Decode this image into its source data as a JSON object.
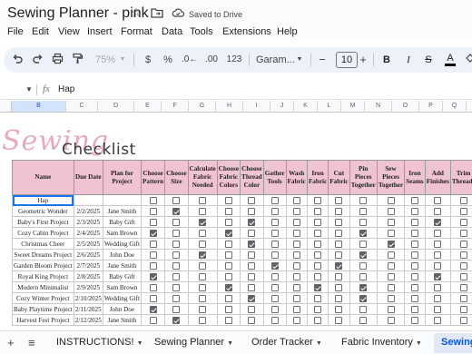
{
  "title_bar": {
    "doc_title": "Sewing Planner - pink",
    "saved_status": "Saved to Drive"
  },
  "menu": [
    "File",
    "Edit",
    "View",
    "Insert",
    "Format",
    "Data",
    "Tools",
    "Extensions",
    "Help"
  ],
  "toolbar": {
    "zoom": "75%",
    "currency": "$",
    "percent": "%",
    "decrease_decimal": ".0←",
    "increase_decimal": ".00",
    "number_format": "123",
    "font": "Garam...",
    "font_size": "10",
    "bold": "B",
    "italic": "I",
    "strikethrough": "S",
    "text_color": "A"
  },
  "formula_bar": {
    "fx": "fx",
    "value": "Hap"
  },
  "columns": [
    "B",
    "C",
    "D",
    "E",
    "F",
    "G",
    "H",
    "I",
    "J",
    "K",
    "L",
    "M",
    "N",
    "O",
    "P",
    "Q",
    "R"
  ],
  "sheet": {
    "script_title": "Sewing",
    "title": "Checklist",
    "headers": [
      "Name",
      "Due Date",
      "Plan for Project",
      "Choose Pattern",
      "Choose Size",
      "Calculate Fabric Needed",
      "Choose Fabric Colors",
      "Choose Thread Color",
      "Gather Tools",
      "Wash Fabric",
      "Iron Fabric",
      "Cut Fabric",
      "Pin Pieces Together",
      "Sew Pieces Together",
      "Iron Seams",
      "Add Finishes",
      "Trim Threads"
    ],
    "rows": [
      {
        "name": "Hap",
        "due": "",
        "plan": "",
        "checks": [
          0,
          0,
          0,
          0,
          0,
          0,
          0,
          0,
          0,
          0,
          0,
          0,
          0,
          0
        ]
      },
      {
        "name": "Geometric Wonder",
        "due": "2/2/2025",
        "plan": "Jane Smith",
        "checks": [
          0,
          1,
          0,
          0,
          0,
          0,
          0,
          0,
          0,
          0,
          0,
          0,
          0,
          0
        ]
      },
      {
        "name": "Baby's First Project",
        "due": "2/3/2025",
        "plan": "Baby Gift",
        "checks": [
          0,
          0,
          1,
          0,
          1,
          0,
          0,
          0,
          0,
          0,
          0,
          0,
          1,
          0
        ]
      },
      {
        "name": "Cozy Cabin Project",
        "due": "2/4/2025",
        "plan": "Sam Brown",
        "checks": [
          1,
          0,
          0,
          1,
          0,
          0,
          0,
          0,
          0,
          1,
          0,
          0,
          0,
          0
        ]
      },
      {
        "name": "Christmas Cheer",
        "due": "2/5/2025",
        "plan": "Wedding Gift",
        "checks": [
          0,
          0,
          0,
          0,
          1,
          0,
          0,
          0,
          0,
          0,
          1,
          0,
          0,
          0
        ]
      },
      {
        "name": "Sweet Dreams Project",
        "due": "2/6/2025",
        "plan": "John Doe",
        "checks": [
          0,
          0,
          1,
          0,
          0,
          0,
          0,
          0,
          0,
          1,
          0,
          0,
          0,
          0
        ]
      },
      {
        "name": "Garden Bloom Project",
        "due": "2/7/2025",
        "plan": "Jane Smith",
        "checks": [
          0,
          0,
          0,
          0,
          0,
          1,
          0,
          0,
          1,
          0,
          0,
          0,
          0,
          0
        ]
      },
      {
        "name": "Royal King Project",
        "due": "2/8/2025",
        "plan": "Baby Gift",
        "checks": [
          1,
          0,
          0,
          0,
          0,
          0,
          0,
          0,
          0,
          0,
          0,
          0,
          1,
          0
        ]
      },
      {
        "name": "Modern Minimalist",
        "due": "2/9/2025",
        "plan": "Sam Brown",
        "checks": [
          0,
          0,
          0,
          1,
          0,
          0,
          0,
          1,
          0,
          1,
          0,
          0,
          0,
          0
        ]
      },
      {
        "name": "Cozy Winter Project",
        "due": "2/10/2025",
        "plan": "Wedding Gift",
        "checks": [
          0,
          0,
          0,
          0,
          1,
          0,
          0,
          0,
          0,
          1,
          0,
          0,
          0,
          0
        ]
      },
      {
        "name": "Baby Playtime Project",
        "due": "2/11/2025",
        "plan": "John Doe",
        "checks": [
          1,
          0,
          0,
          0,
          0,
          0,
          0,
          0,
          0,
          0,
          0,
          0,
          0,
          0
        ]
      },
      {
        "name": "Harvest Fest Project",
        "due": "2/12/2025",
        "plan": "Jane Smith",
        "checks": [
          0,
          1,
          0,
          0,
          0,
          0,
          0,
          0,
          0,
          0,
          0,
          0,
          0,
          0
        ]
      }
    ]
  },
  "tabs": [
    "INSTRUCTIONS!",
    "Sewing Planner",
    "Order Tracker",
    "Fabric Inventory",
    "Sewing"
  ]
}
